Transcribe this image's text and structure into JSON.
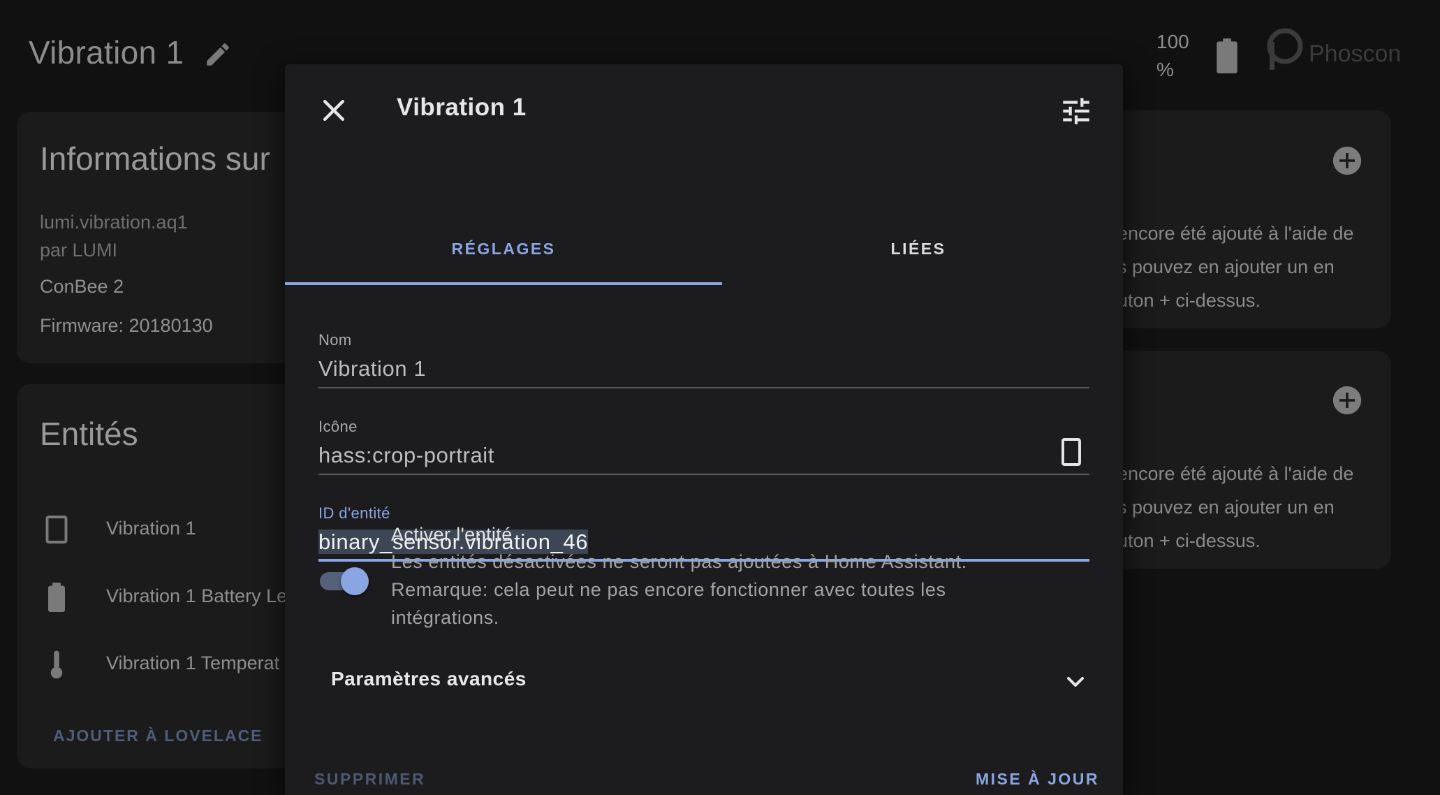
{
  "background": {
    "page_title": "Vibration 1",
    "battery_percent": "100 %",
    "logo_text": "Phoscon",
    "info_card": {
      "title": "Informations sur",
      "model": "lumi.vibration.aq1",
      "manufacturer": "par LUMI",
      "via": "ConBee 2",
      "firmware": "Firmware: 20180130"
    },
    "entities_card": {
      "title": "Entités",
      "items": [
        {
          "label": "Vibration 1",
          "icon": "crop-portrait-icon"
        },
        {
          "label": "Vibration 1 Battery Le",
          "icon": "battery-icon"
        },
        {
          "label": "Vibration 1 Temperat",
          "icon": "thermometer-icon"
        }
      ],
      "add_button": "AJOUTER À LOVELACE"
    },
    "right_cards": [
      {
        "lines": [
          " encore été ajouté à l'aide de",
          "s pouvez en ajouter un en",
          "uton + ci-dessus."
        ]
      },
      {
        "lines": [
          " encore été ajouté à l'aide de",
          "s pouvez en ajouter un en",
          "uton + ci-dessus."
        ]
      }
    ]
  },
  "dialog": {
    "title": "Vibration 1",
    "tabs": [
      {
        "label": "RÉGLAGES",
        "active": true
      },
      {
        "label": "LIÉES",
        "active": false
      }
    ],
    "fields": {
      "name": {
        "label": "Nom",
        "value": "Vibration 1"
      },
      "icon": {
        "label": "Icône",
        "value": "hass:crop-portrait"
      },
      "entity_id": {
        "label": "ID d'entité",
        "value": "binary_sensor.vibration_46"
      }
    },
    "enable": {
      "title": "Activer l'entité",
      "enabled": true,
      "description_line1": "Les entités désactivées ne seront pas ajoutées à Home Assistant.",
      "description_line2": "Remarque: cela peut ne pas encore fonctionner avec toutes les",
      "description_line3": "intégrations."
    },
    "advanced_label": "Paramètres avancés",
    "delete_button": "SUPPRIMER",
    "update_button": "MISE À JOUR"
  },
  "colors": {
    "accent": "#8aa6e2",
    "dialog_bg": "#1c1c1e",
    "page_bg": "#111111"
  }
}
